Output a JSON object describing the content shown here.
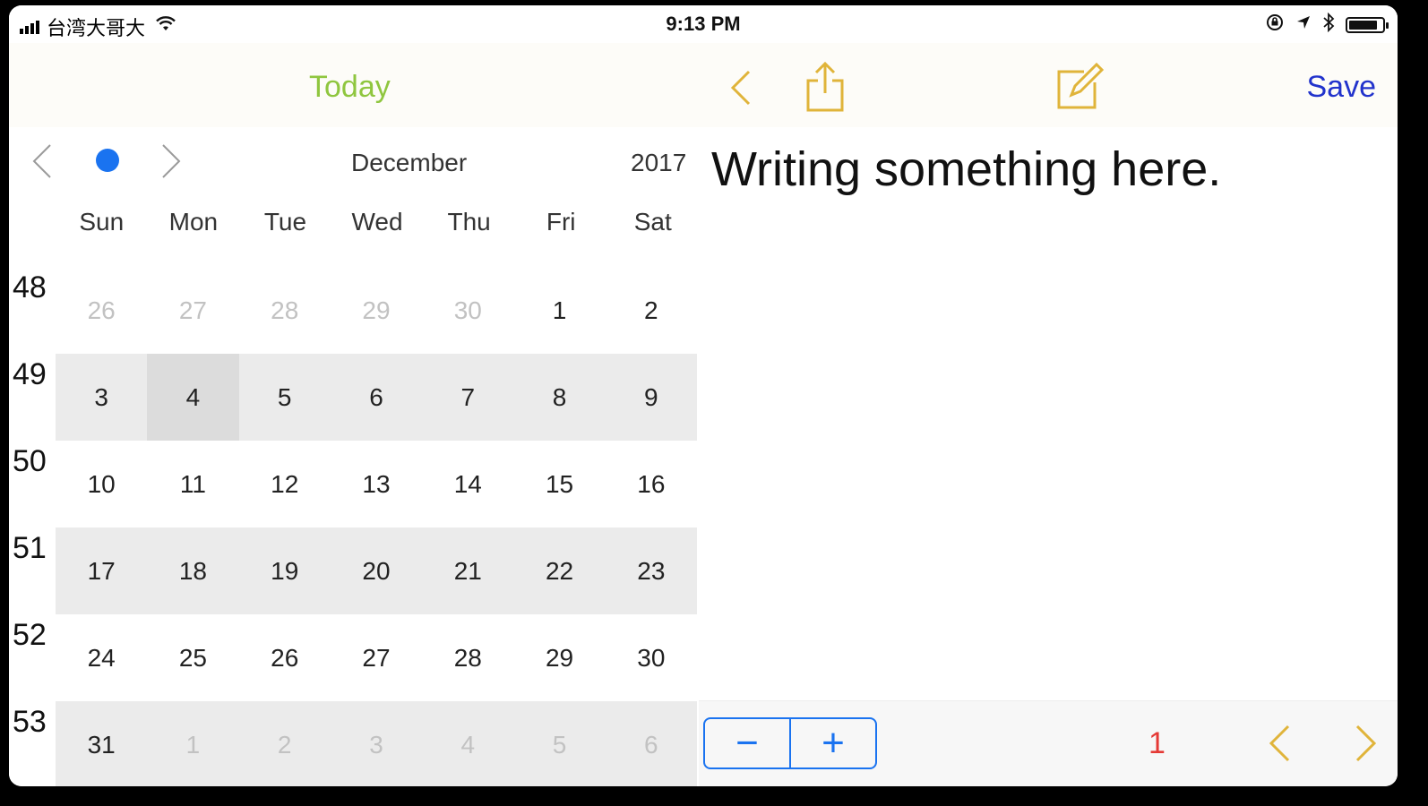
{
  "status_bar": {
    "carrier": "台湾大哥大",
    "time": "9:13 PM",
    "battery_level": 0.85
  },
  "toolbar": {
    "today_label": "Today",
    "save_label": "Save",
    "accent_color": "#e0b43a",
    "today_color": "#8fc63f",
    "save_color": "#2233cc",
    "icons": [
      "back-chevron-icon",
      "share-icon",
      "compose-icon"
    ]
  },
  "calendar": {
    "month": "December",
    "year": "2017",
    "weekdays": [
      "Sun",
      "Mon",
      "Tue",
      "Wed",
      "Thu",
      "Fri",
      "Sat"
    ],
    "selected_color": "#1a73f0",
    "weeks": [
      {
        "number": "48",
        "days": [
          "26",
          "27",
          "28",
          "29",
          "30",
          "1",
          "2"
        ],
        "other": [
          true,
          true,
          true,
          true,
          true,
          false,
          false
        ],
        "shaded": false
      },
      {
        "number": "49",
        "days": [
          "3",
          "4",
          "5",
          "6",
          "7",
          "8",
          "9"
        ],
        "other": [
          false,
          false,
          false,
          false,
          false,
          false,
          false
        ],
        "shaded": true,
        "selected_index": 1
      },
      {
        "number": "50",
        "days": [
          "10",
          "11",
          "12",
          "13",
          "14",
          "15",
          "16"
        ],
        "other": [
          false,
          false,
          false,
          false,
          false,
          false,
          false
        ],
        "shaded": false
      },
      {
        "number": "51",
        "days": [
          "17",
          "18",
          "19",
          "20",
          "21",
          "22",
          "23"
        ],
        "other": [
          false,
          false,
          false,
          false,
          false,
          false,
          false
        ],
        "shaded": true
      },
      {
        "number": "52",
        "days": [
          "24",
          "25",
          "26",
          "27",
          "28",
          "29",
          "30"
        ],
        "other": [
          false,
          false,
          false,
          false,
          false,
          false,
          false
        ],
        "shaded": false
      },
      {
        "number": "53",
        "days": [
          "31",
          "1",
          "2",
          "3",
          "4",
          "5",
          "6"
        ],
        "other": [
          false,
          true,
          true,
          true,
          true,
          true,
          true
        ],
        "shaded": true
      }
    ]
  },
  "editor": {
    "text": "Writing something here."
  },
  "bottom_bar": {
    "minus_label": "−",
    "plus_label": "+",
    "page_number": "1",
    "page_color": "#e53935"
  }
}
